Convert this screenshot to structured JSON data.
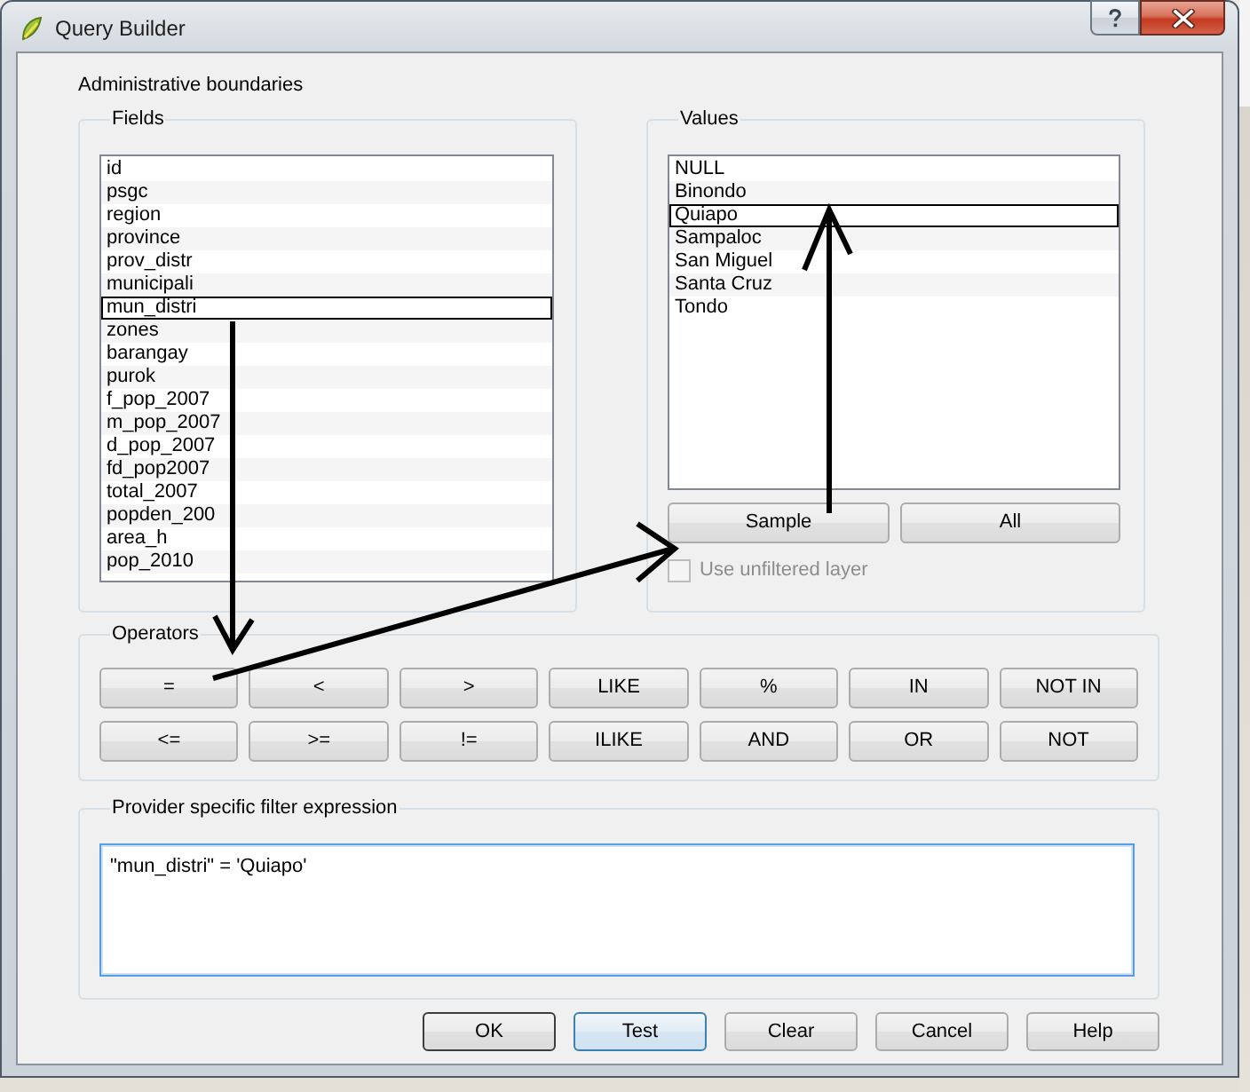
{
  "window": {
    "title": "Query Builder"
  },
  "layer": {
    "name": "Administrative boundaries"
  },
  "fields": {
    "title": "Fields",
    "items": [
      {
        "label": "id",
        "selected": false
      },
      {
        "label": "psgc",
        "selected": false
      },
      {
        "label": "region",
        "selected": false
      },
      {
        "label": "province",
        "selected": false
      },
      {
        "label": "prov_distr",
        "selected": false
      },
      {
        "label": "municipali",
        "selected": false
      },
      {
        "label": "mun_distri",
        "selected": true
      },
      {
        "label": "zones",
        "selected": false
      },
      {
        "label": "barangay",
        "selected": false
      },
      {
        "label": "purok",
        "selected": false
      },
      {
        "label": "f_pop_2007",
        "selected": false
      },
      {
        "label": "m_pop_2007",
        "selected": false
      },
      {
        "label": "d_pop_2007",
        "selected": false
      },
      {
        "label": "fd_pop2007",
        "selected": false
      },
      {
        "label": "total_2007",
        "selected": false
      },
      {
        "label": "popden_200",
        "selected": false
      },
      {
        "label": "area_h",
        "selected": false
      },
      {
        "label": "pop_2010",
        "selected": false
      }
    ]
  },
  "values": {
    "title": "Values",
    "items": [
      {
        "label": "NULL",
        "selected": false
      },
      {
        "label": "Binondo",
        "selected": false
      },
      {
        "label": "Quiapo",
        "selected": true
      },
      {
        "label": "Sampaloc",
        "selected": false
      },
      {
        "label": "San Miguel",
        "selected": false
      },
      {
        "label": "Santa Cruz",
        "selected": false
      },
      {
        "label": "Tondo",
        "selected": false
      }
    ],
    "buttons": [
      "Sample",
      "All"
    ],
    "use_unfiltered_layer": {
      "label": "Use unfiltered layer",
      "checked": false,
      "disabled": true
    }
  },
  "operators": {
    "title": "Operators",
    "rows": [
      [
        "=",
        "<",
        ">",
        "LIKE",
        "%",
        "IN",
        "NOT IN"
      ],
      [
        "<=",
        ">=",
        "!=",
        "ILIKE",
        "AND",
        "OR",
        "NOT"
      ]
    ]
  },
  "filter_expression": {
    "title": "Provider specific filter expression",
    "value": "\"mun_distri\" = 'Quiapo'",
    "focused": true
  },
  "dialog_buttons": [
    {
      "label": "OK",
      "default": true,
      "hovered": false
    },
    {
      "label": "Test",
      "default": false,
      "hovered": true
    },
    {
      "label": "Clear",
      "default": false,
      "hovered": false
    },
    {
      "label": "Cancel",
      "default": false,
      "hovered": false
    },
    {
      "label": "Help",
      "default": false,
      "hovered": false
    }
  ]
}
